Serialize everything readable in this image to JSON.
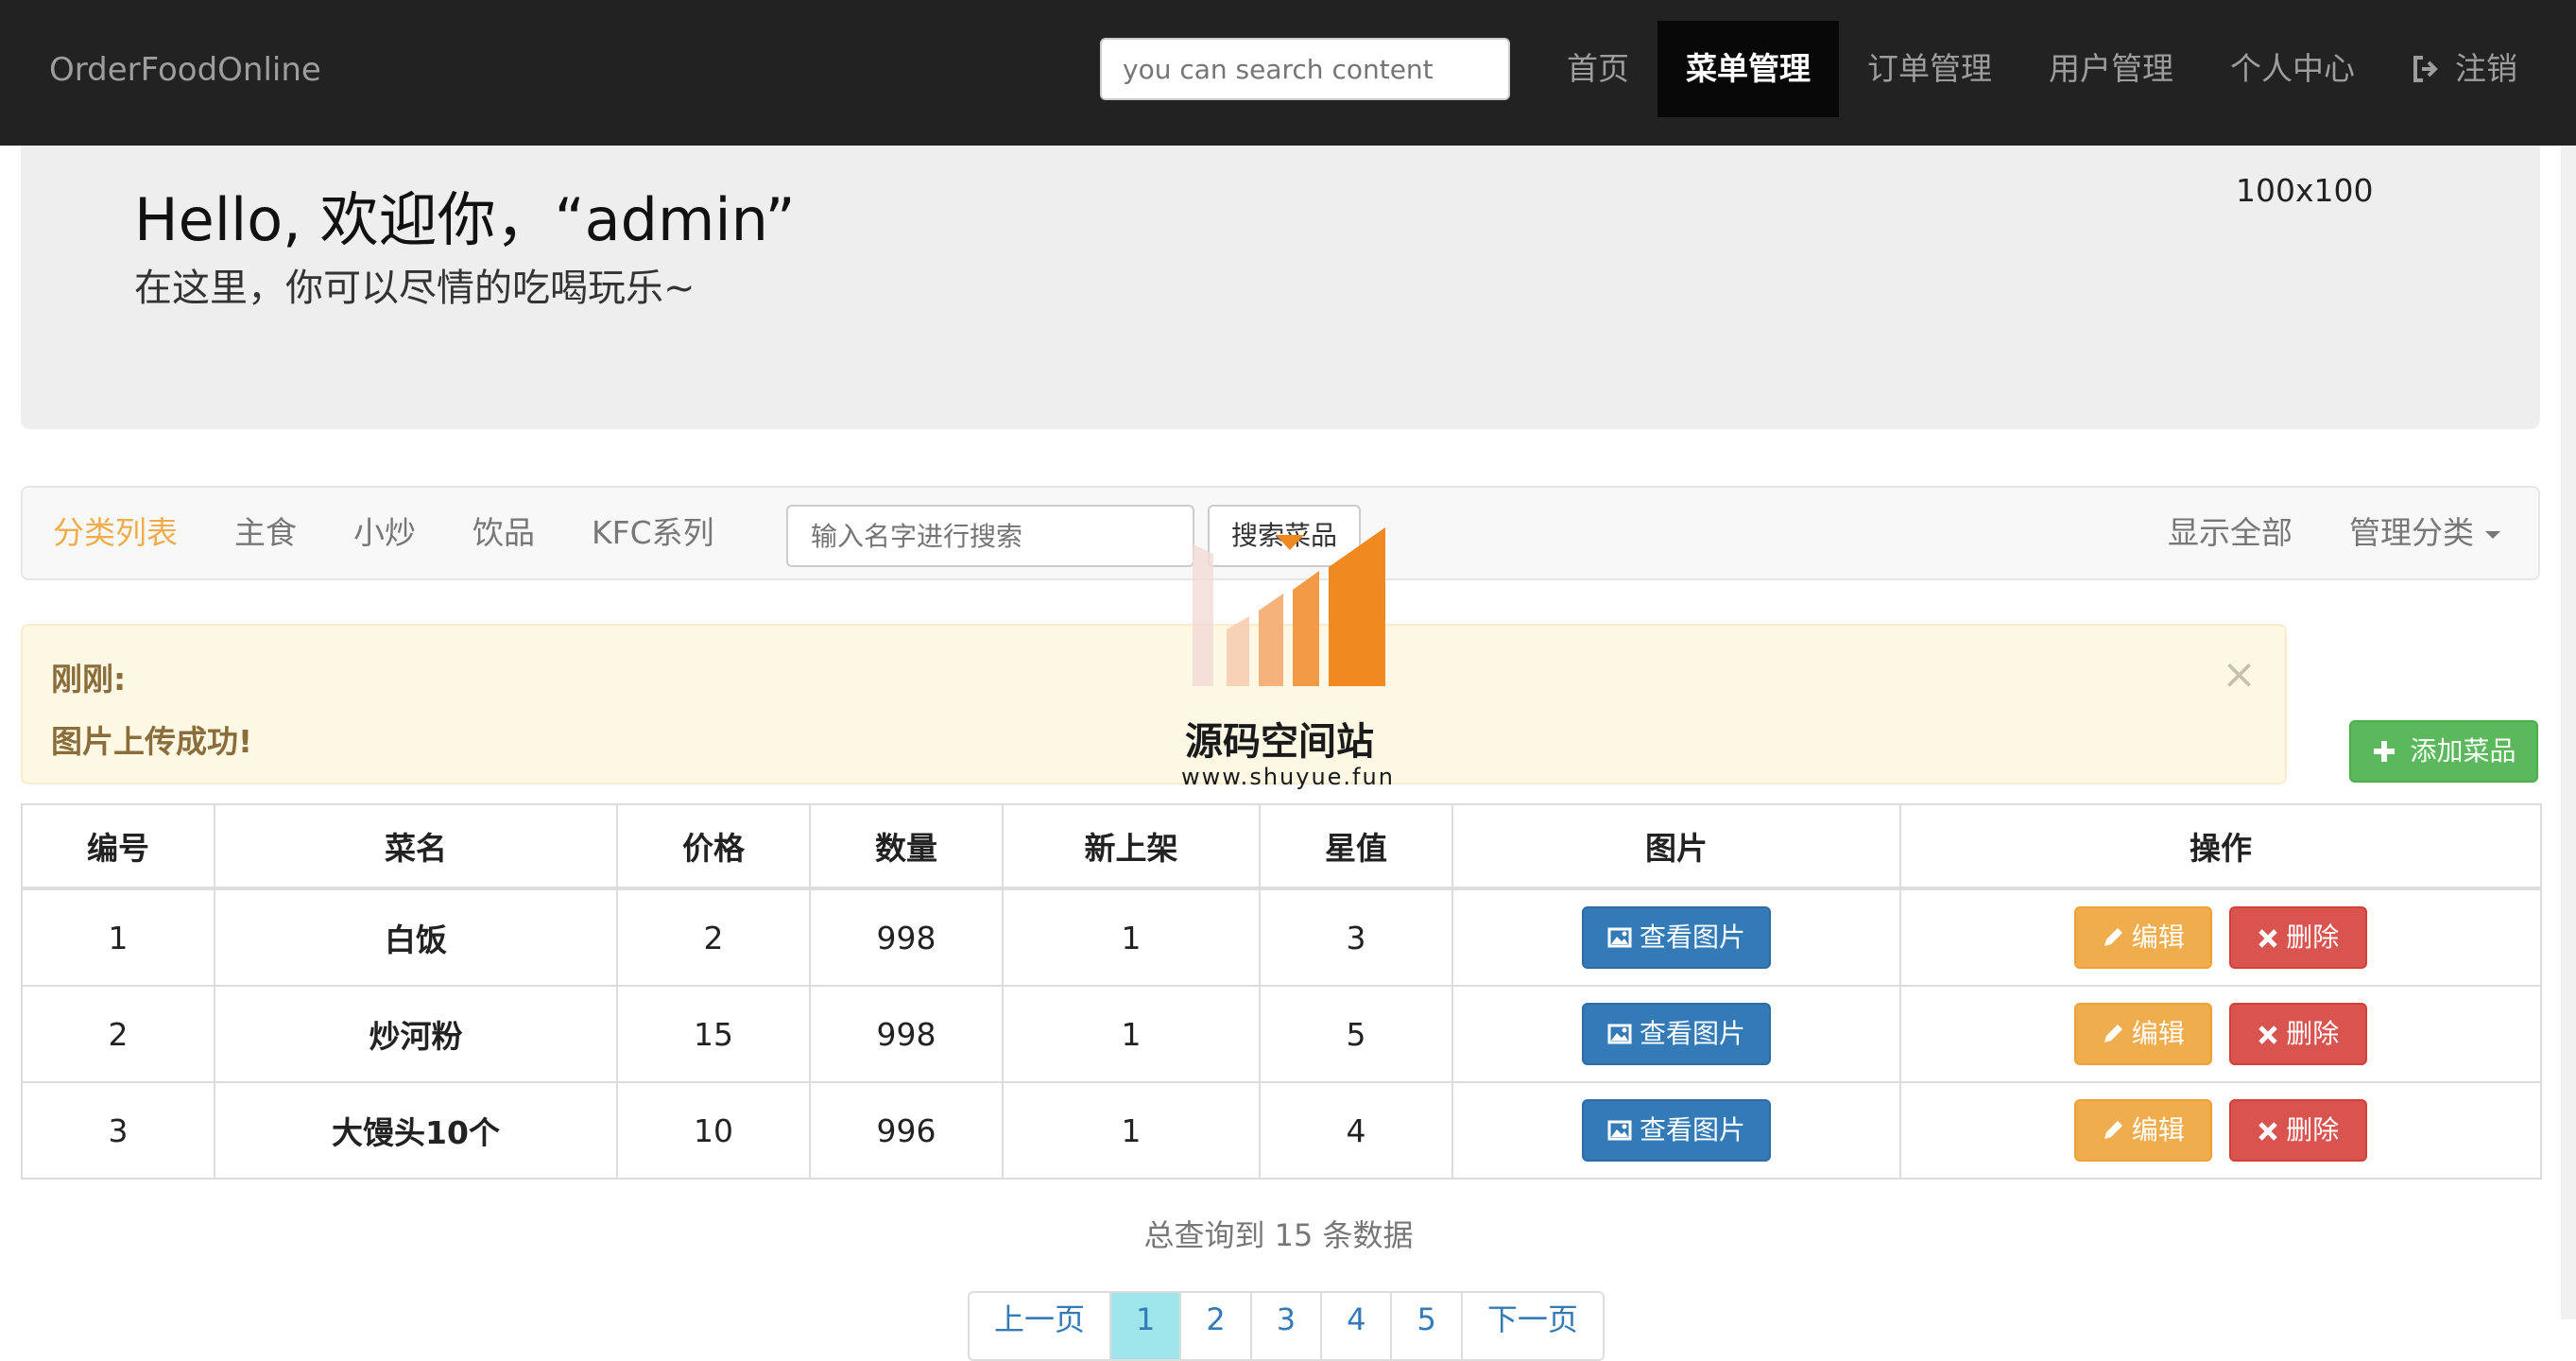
{
  "navbar": {
    "brand": "OrderFoodOnline",
    "search_placeholder": "you can search content",
    "links": [
      {
        "label": "首页"
      },
      {
        "label": "菜单管理"
      },
      {
        "label": "订单管理"
      },
      {
        "label": "用户管理"
      },
      {
        "label": "个人中心"
      },
      {
        "label": "注销",
        "icon": "logout-icon"
      }
    ]
  },
  "jumbotron": {
    "greeting": "Hello, 欢迎你，“admin”",
    "subtitle": "在这里，你可以尽情的吃喝玩乐~",
    "image_placeholder": "100x100"
  },
  "category_bar": {
    "brand": "分类列表",
    "items": [
      "主食",
      "小炒",
      "饮品",
      "KFC系列"
    ],
    "search_placeholder": "输入名字进行搜索",
    "search_button": "搜索菜品",
    "show_all": "显示全部",
    "manage": "管理分类"
  },
  "alert": {
    "title": "刚刚:",
    "message": "图片上传成功!",
    "close": "×"
  },
  "add_button": "添加菜品",
  "watermark": {
    "text": "源码空间站",
    "url": "www.shuyue.fun"
  },
  "table": {
    "headers": [
      "编号",
      "菜名",
      "价格",
      "数量",
      "新上架",
      "星值",
      "图片",
      "操作"
    ],
    "rows": [
      {
        "id": "1",
        "name": "白饭",
        "price": "2",
        "qty": "998",
        "new": "1",
        "stars": "3"
      },
      {
        "id": "2",
        "name": "炒河粉",
        "price": "15",
        "qty": "998",
        "new": "1",
        "stars": "5"
      },
      {
        "id": "3",
        "name": "大馒头10个",
        "price": "10",
        "qty": "996",
        "new": "1",
        "stars": "4"
      }
    ],
    "view_image_label": "查看图片",
    "edit_label": "编辑",
    "delete_label": "删除"
  },
  "footer": {
    "total_text": "总查询到 15 条数据"
  },
  "pagination": [
    "上一页",
    "1",
    "2",
    "3",
    "4",
    "5",
    "下一页"
  ],
  "colors": {
    "navbar_bg": "#222222",
    "brand_orange": "#f0ad4e",
    "primary": "#337ab7",
    "warning": "#f0ad4e",
    "danger": "#d9534f",
    "success": "#5cb85c"
  }
}
